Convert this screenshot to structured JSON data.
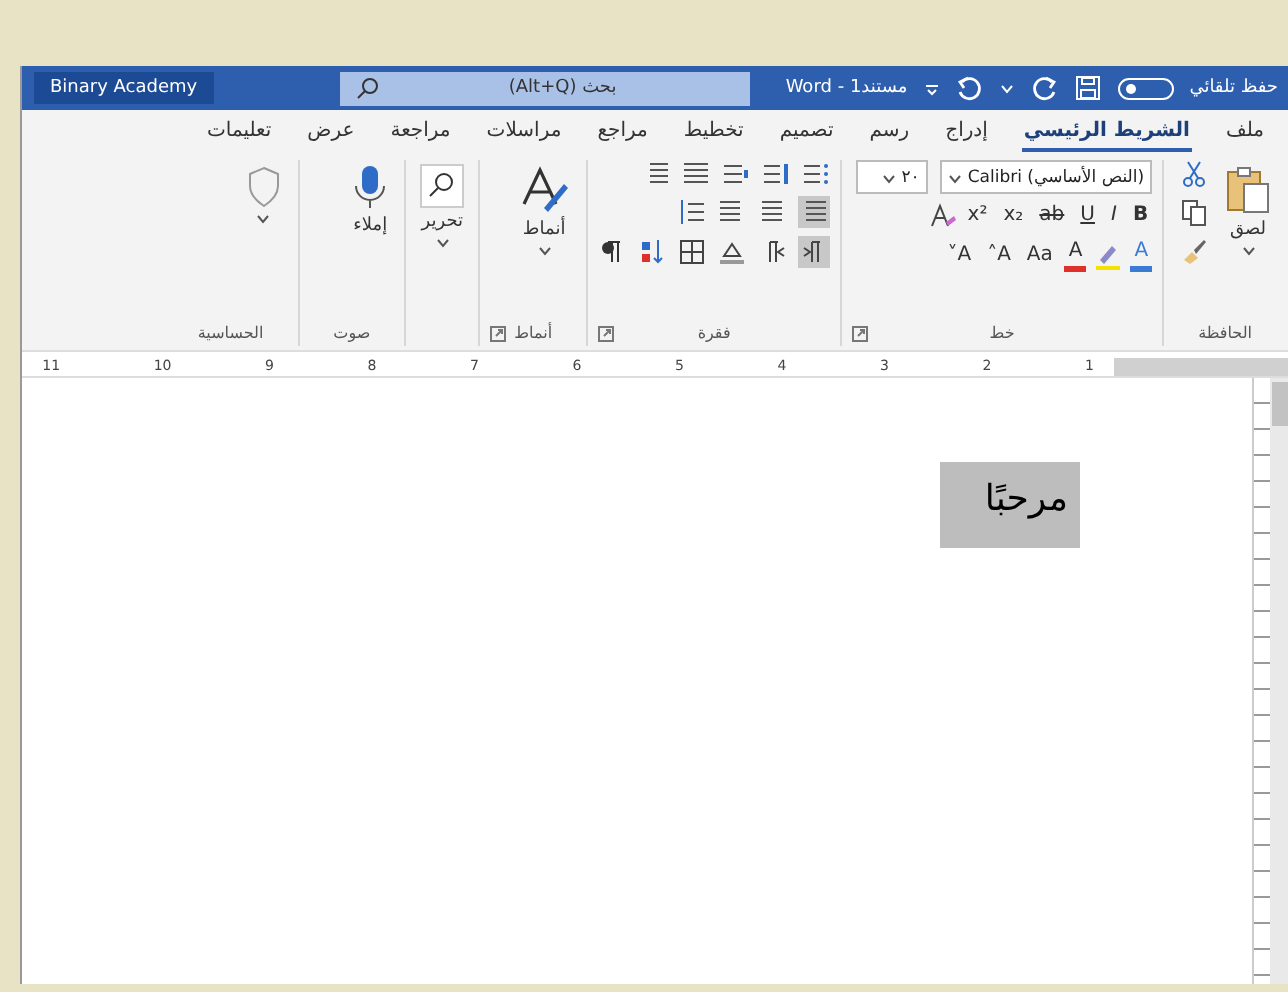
{
  "title_bar": {
    "autosave_label": "حفظ تلقائي",
    "autosave_on": false,
    "document_title": "مستند1 - Word",
    "search": {
      "placeholder": "بحث (Alt+Q)"
    },
    "user_name": "Binary Academy"
  },
  "tabs": [
    {
      "label": "ملف",
      "selected": false
    },
    {
      "label": "الشريط الرئيسي",
      "selected": true
    },
    {
      "label": "إدراج",
      "selected": false
    },
    {
      "label": "رسم",
      "selected": false
    },
    {
      "label": "تصميم",
      "selected": false
    },
    {
      "label": "تخطيط",
      "selected": false
    },
    {
      "label": "مراجع",
      "selected": false
    },
    {
      "label": "مراسلات",
      "selected": false
    },
    {
      "label": "مراجعة",
      "selected": false
    },
    {
      "label": "عرض",
      "selected": false
    },
    {
      "label": "تعليمات",
      "selected": false
    }
  ],
  "ribbon": {
    "clipboard": {
      "label": "الحافظة",
      "paste_label": "لصق"
    },
    "font": {
      "label": "خط",
      "font_name": "(النص الأساسي) Calibri",
      "font_size": "٢٠",
      "row_2": [
        "B",
        "I",
        "U",
        "ab",
        "x₂",
        "x²"
      ],
      "row_3": [
        {
          "label": "A",
          "color": "#3a7bd5"
        },
        {
          "label": "A",
          "color": "#e0302b"
        },
        {
          "label": "Aa"
        },
        {
          "label": "A˄"
        },
        {
          "label": "A˅"
        }
      ]
    },
    "paragraph": {
      "label": "فقرة",
      "rtl_pressed": true,
      "align_right_pressed": true
    },
    "styles": {
      "label": "أنماط",
      "button_label": "أنماط"
    },
    "editing": {
      "button_label": "تحرير"
    },
    "voice": {
      "label": "صوت",
      "button_label": "إملاء"
    },
    "sensitivity": {
      "label": "الحساسية"
    }
  },
  "ruler": [
    "1",
    "2",
    "3",
    "4",
    "5",
    "6",
    "7",
    "8",
    "9",
    "10",
    "11"
  ],
  "document": {
    "text": "مرحبًا"
  }
}
